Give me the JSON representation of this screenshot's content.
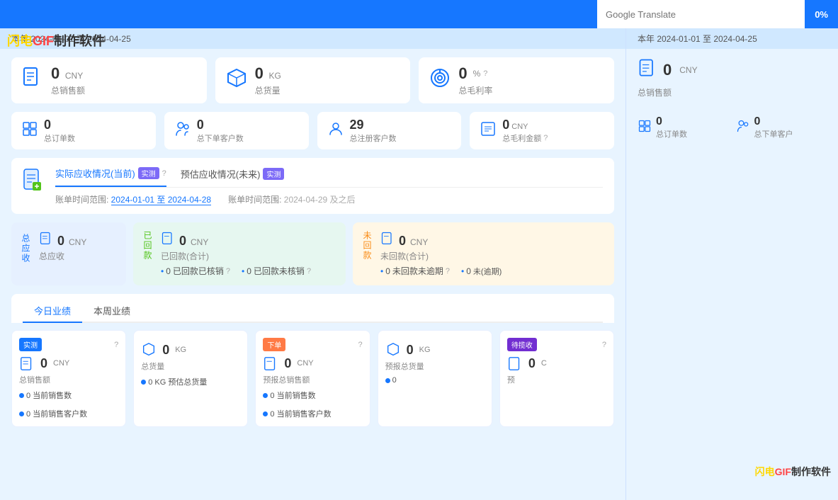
{
  "app": {
    "title_flash": "闪电",
    "title_gif": "GIF",
    "title_rest": "制作软件"
  },
  "header": {
    "year": "2024",
    "date_range": "本年 2024-01-01 至 2024-04-25"
  },
  "google_translate": {
    "label": "Google Translate",
    "pct": "0%"
  },
  "left_stats_large": [
    {
      "value": "0",
      "unit": "CNY",
      "label": "总销售额"
    },
    {
      "value": "0",
      "unit": "KG",
      "label": "总货量"
    },
    {
      "value": "0",
      "unit": "%",
      "label": "总毛利率"
    }
  ],
  "left_stats_small": [
    {
      "value": "0",
      "label": "总订单数"
    },
    {
      "value": "0",
      "label": "总下单客户数"
    },
    {
      "value": "29",
      "label": "总注册客户数"
    },
    {
      "value": "0",
      "unit": "CNY",
      "label": "总毛利金额"
    }
  ],
  "receivables": {
    "tab1_label": "实际应收情况(当前)",
    "tab1_badge": "实测",
    "tab2_label": "预估应收情况(未来)",
    "tab2_badge": "实测",
    "tab1_range": "账单时间范围: 2024-01-01 至 2024-04-28",
    "tab2_range": "账单时间范围: 2024-04-29 及之后",
    "cards": {
      "total": {
        "label": "总应收",
        "side": "总应收",
        "value": "0",
        "unit": "CNY",
        "sub_label": "总应收"
      },
      "returned": {
        "side": "已回款",
        "main_value": "0",
        "main_unit": "CNY",
        "main_label": "已回款(合计)",
        "sub1_value": "0",
        "sub1_label": "已回款已核销",
        "sub2_value": "0",
        "sub2_label": "已回款未核销"
      },
      "unreturned": {
        "side": "未回款",
        "main_value": "0",
        "main_unit": "CNY",
        "main_label": "未回款(合计)",
        "sub1_value": "0",
        "sub1_label": "未回款未逾期",
        "sub2_label": "未",
        "sub3_value": "0"
      }
    }
  },
  "performance": {
    "tab1": "今日业绩",
    "tab2": "本周业绩",
    "cards": [
      {
        "badge": "实测",
        "badge_type": "blue",
        "value": "0",
        "unit": "CNY",
        "label": "总销售额",
        "dots": [
          {
            "val": "0",
            "label": "当前销售数"
          },
          {
            "val": "0",
            "label": "当前销售客户数"
          }
        ]
      },
      {
        "badge": "",
        "badge_type": "",
        "value": "0",
        "unit": "KG",
        "label": "总货量",
        "dots": [
          {
            "val": "0 KG",
            "label": "预估总货量"
          }
        ]
      },
      {
        "badge": "下单",
        "badge_type": "orange",
        "value": "0",
        "unit": "CNY",
        "label": "预报总销售额",
        "dots": [
          {
            "val": "0",
            "label": "当前销售数"
          },
          {
            "val": "0",
            "label": "当前销售客户数"
          }
        ]
      },
      {
        "badge": "",
        "badge_type": "",
        "value": "0",
        "unit": "KG",
        "label": "预报总货量",
        "dots": [
          {
            "val": "0",
            "label": ""
          }
        ]
      },
      {
        "badge": "待揽收",
        "badge_type": "purple",
        "value": "0",
        "unit": "CNY",
        "label": "预",
        "dots": []
      }
    ]
  },
  "right_panel": {
    "stats_large": [
      {
        "value": "0",
        "unit": "CNY",
        "label": "总销售额"
      }
    ],
    "stats_small": [
      {
        "value": "0",
        "label": "总订单数"
      },
      {
        "value": "0",
        "label": "总下单客户"
      }
    ]
  },
  "watermark": {
    "text": "闪电GIF制作软件"
  }
}
